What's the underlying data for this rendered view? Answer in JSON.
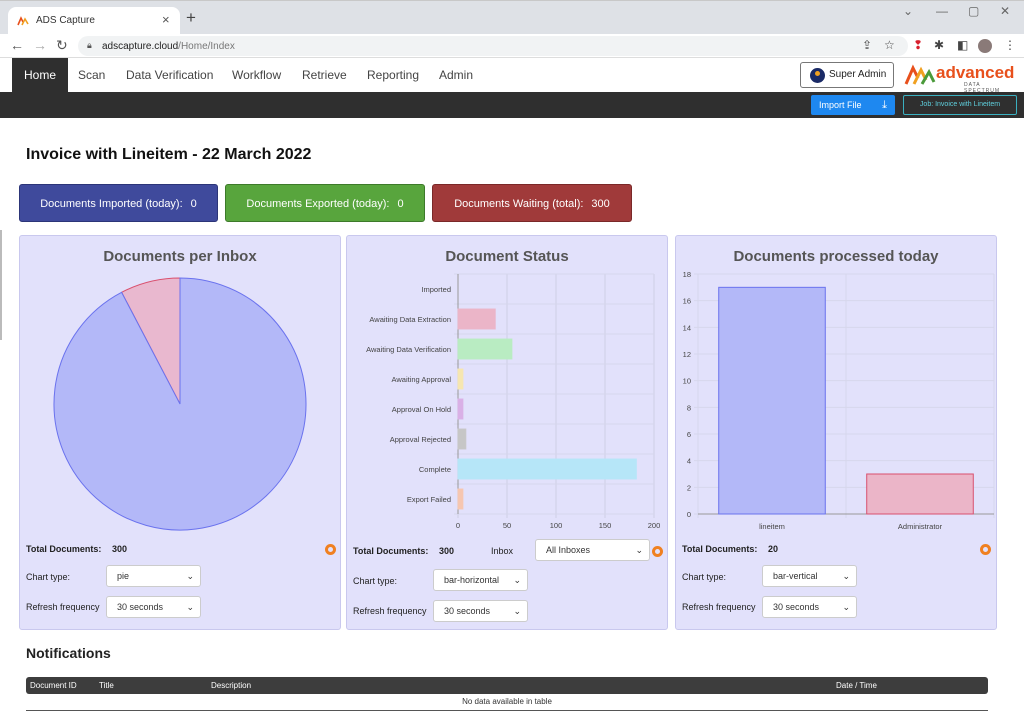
{
  "browser": {
    "tab_title": "ADS Capture",
    "url_host": "adscapture.cloud",
    "url_path": "/Home/Index"
  },
  "nav": {
    "items": [
      "Home",
      "Scan",
      "Data Verification",
      "Workflow",
      "Retrieve",
      "Reporting",
      "Admin"
    ],
    "user_label": "Super Admin",
    "logo_text": "advanced",
    "logo_sub": "DATA SPECTRUM"
  },
  "toolbar": {
    "import_label": "Import File",
    "job_label": "Job: Invoice with Lineitem"
  },
  "page": {
    "title": "Invoice with Lineitem - 22 March 2022"
  },
  "stats": [
    {
      "label": "Documents Imported (today):",
      "value": "0",
      "color": "#3f4a9c"
    },
    {
      "label": "Documents Exported (today):",
      "value": "0",
      "color": "#58a53d"
    },
    {
      "label": "Documents Waiting (total):",
      "value": "300",
      "color": "#a03a3a"
    }
  ],
  "panels": {
    "inbox": {
      "title": "Documents per Inbox",
      "total_label": "Total Documents:",
      "total_value": "300",
      "chart_type_label": "Chart type:",
      "chart_type_value": "pie",
      "refresh_label": "Refresh frequency",
      "refresh_value": "30 seconds"
    },
    "status": {
      "title": "Document Status",
      "total_label": "Total Documents:",
      "total_value": "300",
      "inbox_label": "Inbox",
      "inbox_value": "All Inboxes",
      "chart_type_label": "Chart type:",
      "chart_type_value": "bar-horizontal",
      "refresh_label": "Refresh frequency",
      "refresh_value": "30 seconds"
    },
    "processed": {
      "title": "Documents processed today",
      "total_label": "Total Documents:",
      "total_value": "20",
      "chart_type_label": "Chart type:",
      "chart_type_value": "bar-vertical",
      "refresh_label": "Refresh frequency",
      "refresh_value": "30 seconds"
    }
  },
  "notifications": {
    "title": "Notifications",
    "columns": [
      "Document ID",
      "Title",
      "Description",
      "Date / Time"
    ],
    "empty_text": "No data available in table"
  },
  "chart_data": [
    {
      "type": "pie",
      "values": [
        277,
        23
      ],
      "colors": [
        "#b3b8f8",
        "#e9b8cf"
      ],
      "stroke_colors": [
        "#6a72ee",
        "#d9506e"
      ]
    },
    {
      "type": "bar",
      "orientation": "horizontal",
      "categories": [
        "Imported",
        "Awaiting Data Extraction",
        "Awaiting Data Verification",
        "Awaiting Approval",
        "Approval On Hold",
        "Approval Rejected",
        "Complete",
        "Export Failed"
      ],
      "values": [
        0,
        38,
        55,
        5,
        5,
        8,
        182,
        5
      ],
      "colors": [
        "#b3b8f8",
        "#ebb5c8",
        "#b9ecc2",
        "#f6e6b0",
        "#d9b0e6",
        "#c6c6c6",
        "#b6e6f8",
        "#f6c6b0"
      ],
      "xlim": [
        0,
        200
      ],
      "xticks": [
        0,
        50,
        100,
        150,
        200
      ]
    },
    {
      "type": "bar",
      "orientation": "vertical",
      "categories": [
        "lineitem",
        "Administrator"
      ],
      "values": [
        17,
        3
      ],
      "colors": [
        "#b3b8f8",
        "#ebb5c8"
      ],
      "stroke_colors": [
        "#6a72ee",
        "#d9506e"
      ],
      "ylim": [
        0,
        18
      ],
      "yticks": [
        0,
        2,
        4,
        6,
        8,
        10,
        12,
        14,
        16,
        18
      ]
    }
  ]
}
